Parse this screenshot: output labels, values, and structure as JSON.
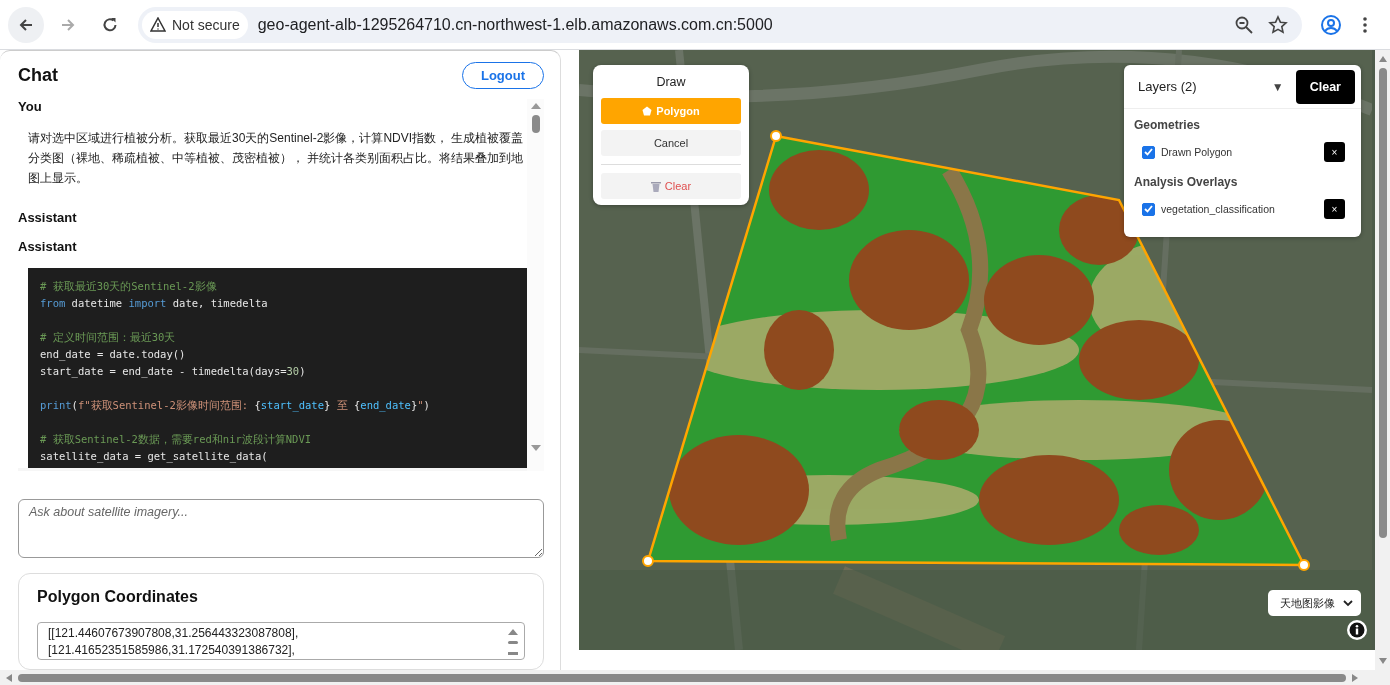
{
  "browser": {
    "security": "Not secure",
    "url": "geo-agent-alb-1295264710.cn-northwest-1.elb.amazonaws.com.cn:5000"
  },
  "chat": {
    "title": "Chat",
    "logout": "Logout",
    "messages": [
      {
        "role": "You",
        "text": "请对选中区域进行植被分析。获取最近30天的Sentinel-2影像，计算NDVI指数， 生成植被覆盖分类图（裸地、稀疏植被、中等植被、茂密植被）， 并统计各类别面积占比。将结果叠加到地图上显示。"
      },
      {
        "role": "Assistant"
      },
      {
        "role": "Assistant",
        "code": [
          [
            [
              {
                "kind": "comment",
                "text": "# 获取最近30天的Sentinel-2影像"
              }
            ],
            [
              {
                "kind": "keyword",
                "text": "from"
              },
              {
                "kind": "plain",
                "text": " datetime "
              },
              {
                "kind": "keyword",
                "text": "import"
              },
              {
                "kind": "plain",
                "text": " date, timedelta"
              }
            ]
          ],
          [
            [
              {
                "kind": "comment",
                "text": "# 定义时间范围：最近30天"
              }
            ],
            [
              {
                "kind": "plain",
                "text": "end_date = date.today()"
              }
            ],
            [
              {
                "kind": "plain",
                "text": "start_date = end_date - timedelta(days="
              },
              {
                "kind": "number",
                "text": "30"
              },
              {
                "kind": "plain",
                "text": ")"
              }
            ]
          ],
          [
            [
              {
                "kind": "keyword",
                "text": "print"
              },
              {
                "kind": "plain",
                "text": "("
              },
              {
                "kind": "string",
                "text": "f\"获取Sentinel-2影像时间范围: "
              },
              {
                "kind": "plain",
                "text": "{"
              },
              {
                "kind": "variable",
                "text": "start_date"
              },
              {
                "kind": "plain",
                "text": "}"
              },
              {
                "kind": "string",
                "text": " 至 "
              },
              {
                "kind": "plain",
                "text": "{"
              },
              {
                "kind": "variable",
                "text": "end_date"
              },
              {
                "kind": "plain",
                "text": "}"
              },
              {
                "kind": "string",
                "text": "\""
              },
              {
                "kind": "plain",
                "text": ")"
              }
            ]
          ],
          [
            [
              {
                "kind": "comment",
                "text": "# 获取Sentinel-2数据，需要red和nir波段计算NDVI"
              }
            ],
            [
              {
                "kind": "plain",
                "text": "satellite_data = get_satellite_data("
              }
            ]
          ]
        ]
      }
    ],
    "input": {
      "placeholder": "Ask about satellite imagery..."
    },
    "coordinates": {
      "title": "Polygon Coordinates",
      "lines": [
        "[[121.44607673907808,31.256443323087808],",
        "[121.41652351585986,31.172540391386732],"
      ]
    }
  },
  "map": {
    "draw": {
      "title": "Draw",
      "tools": [
        {
          "kind": "polygon",
          "label": "Polygon",
          "selected": true
        },
        {
          "kind": "cancel",
          "label": "Cancel",
          "selected": false
        },
        {
          "kind": "clear",
          "label": "Clear",
          "selected": false
        }
      ]
    },
    "layers": {
      "title": "Layers (2)",
      "toggle": "▼",
      "clear": "Clear",
      "groups": [
        {
          "title": "Geometries",
          "items": [
            {
              "label": "Drawn Polygon",
              "checked": true,
              "remove": "×"
            }
          ]
        },
        {
          "title": "Analysis Overlays",
          "items": [
            {
              "label": "vegetation_classification",
              "checked": true,
              "remove": "×"
            }
          ]
        }
      ]
    },
    "basemap": {
      "value": "天地图影像"
    }
  }
}
